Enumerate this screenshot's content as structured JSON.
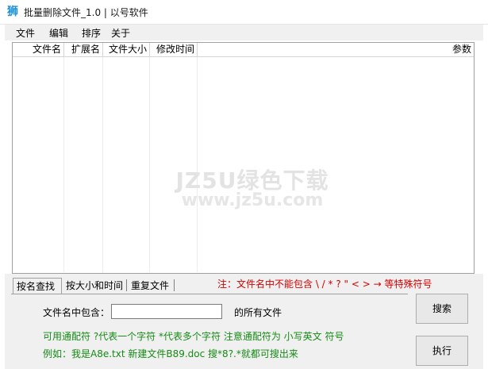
{
  "window": {
    "title": "批量删除文件_1.0 | 以号软件",
    "icon": "app-logo-icon"
  },
  "menu": [
    "文件",
    "编辑",
    "排序",
    "关于"
  ],
  "list": {
    "columns": [
      "文件名",
      "扩展名",
      "文件大小",
      "修改时间",
      "参数"
    ]
  },
  "watermark": {
    "main": "JZ5U绿色下载",
    "sub": "www.jz5u.com"
  },
  "tabs": [
    "按名查找",
    "按大小和时间",
    "重复文件"
  ],
  "note": "注：文件名中不能包含 \\ /  * ? \" < > → 等特殊符号",
  "search": {
    "label_before": "文件名中包含：",
    "value": "",
    "label_after": "的所有文件",
    "hint": "可用通配符 ?代表一个字符 *代表多个字符  注意通配符为 小写英文 符号",
    "example": "例如：我是A8e.txt 新建文件B89.doc 搜*8?.*就都可搜出来"
  },
  "buttons": {
    "search": "搜索",
    "execute": "执行"
  }
}
